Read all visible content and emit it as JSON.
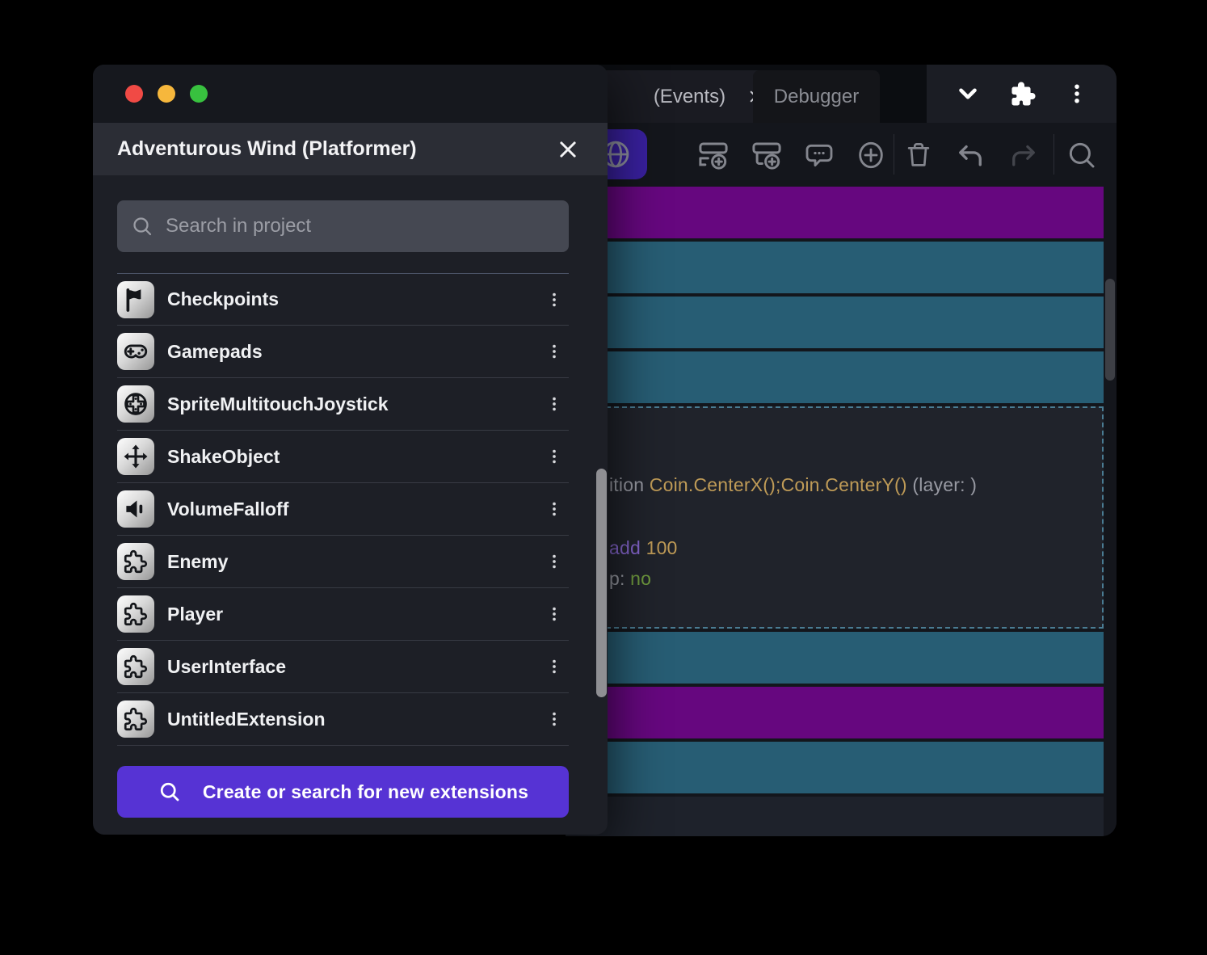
{
  "window": {
    "tabs": [
      {
        "label": "(Events)",
        "active": true,
        "closable": true
      },
      {
        "label": "Debugger",
        "active": false
      }
    ],
    "tab_actions_icons": [
      "chevron-down-icon",
      "extensions-puzzle-icon",
      "kebab-menu-icon"
    ],
    "toolbar": {
      "icons": [
        "globe-icon",
        "add-event-icon",
        "add-subevent-icon",
        "add-comment-icon",
        "add-other-event-icon",
        "delete-icon",
        "undo-icon",
        "redo-icon",
        "search-icon"
      ],
      "accent_button_color": "#39209f"
    },
    "events": {
      "rows": [
        {
          "kind": "comment",
          "color": "#66077f"
        },
        {
          "kind": "event",
          "color": "#275d74"
        },
        {
          "kind": "event",
          "color": "#275d74"
        },
        {
          "kind": "event",
          "color": "#275d74"
        },
        {
          "kind": "selected-event",
          "color": "#20232b"
        },
        {
          "kind": "event",
          "color": "#275d74"
        },
        {
          "kind": "comment",
          "color": "#66077f"
        },
        {
          "kind": "event",
          "color": "#275d74"
        }
      ],
      "selected_code": {
        "line1_prefix": "ition ",
        "line1_expression": "Coin.CenterX();Coin.CenterY()",
        "line1_suffix": " (layer: )",
        "line2_keyword": "add ",
        "line2_value": "100",
        "line3_label": "p: ",
        "line3_value": "no"
      },
      "selection_border_color": "#4a7c93"
    }
  },
  "dialog": {
    "title": "Adventurous Wind (Platformer)",
    "window_controls": [
      "close-traffic-light",
      "minimize-traffic-light",
      "zoom-traffic-light"
    ],
    "search": {
      "placeholder": "Search in project",
      "value": ""
    },
    "items": [
      {
        "label": "Checkpoints",
        "icon": "flag-icon"
      },
      {
        "label": "Gamepads",
        "icon": "gamepad-icon"
      },
      {
        "label": "SpriteMultitouchJoystick",
        "icon": "joystick-icon"
      },
      {
        "label": "ShakeObject",
        "icon": "move-arrows-icon"
      },
      {
        "label": "VolumeFalloff",
        "icon": "speaker-icon"
      },
      {
        "label": "Enemy",
        "icon": "puzzle-icon"
      },
      {
        "label": "Player",
        "icon": "puzzle-icon"
      },
      {
        "label": "UserInterface",
        "icon": "puzzle-icon"
      },
      {
        "label": "UntitledExtension",
        "icon": "puzzle-icon"
      }
    ],
    "cta_label": "Create or search for new extensions"
  },
  "colors": {
    "accent_purple": "#5633d4",
    "toolbar_button_purple": "#39209f",
    "event_comment_purple": "#66077f",
    "event_teal": "#275d74",
    "traffic_red": "#f04a45",
    "traffic_yellow": "#f6b73c",
    "traffic_green": "#38c13f",
    "code_gray": "#989aa3",
    "code_gold": "#bf9b57",
    "code_purple": "#8465cc",
    "code_green": "#6f9a3e"
  }
}
